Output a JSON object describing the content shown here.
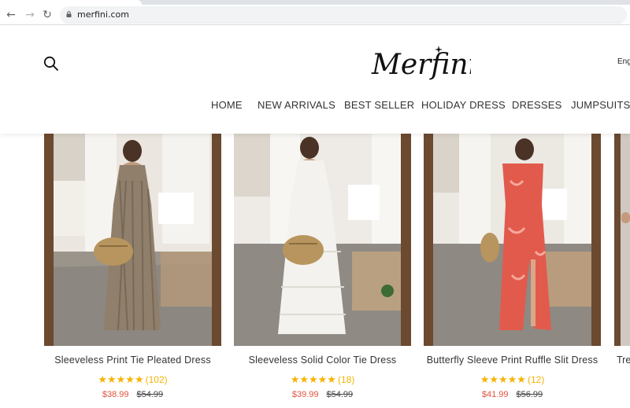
{
  "browser": {
    "url": "merfini.com",
    "back_icon": "arrow-left-icon",
    "forward_icon": "arrow-right-icon",
    "reload_icon": "reload-icon"
  },
  "header": {
    "logo_text": "Merfini",
    "language": "Eng",
    "search_icon": "search-icon",
    "nav": [
      "HOME",
      "NEW ARRIVALS",
      "BEST SELLER",
      "HOLIDAY DRESS",
      "DRESSES",
      "JUMPSUITS"
    ]
  },
  "products": [
    {
      "name": "Sleeveless Print Tie Pleated Dress",
      "stars": "★★★★★",
      "reviews": "(102)",
      "sale_price": "$38.99",
      "original_price": "$54.99",
      "dress_color": "#8f7f6b"
    },
    {
      "name": "Sleeveless Solid Color Tie Dress",
      "stars": "★★★★★",
      "reviews": "(18)",
      "sale_price": "$39.99",
      "original_price": "$54.99",
      "dress_color": "#f4f2ee"
    },
    {
      "name": "Butterfly Sleeve Print Ruffle Slit Dress",
      "stars": "★★★★★",
      "reviews": "(12)",
      "sale_price": "$41.99",
      "original_price": "$56.99",
      "dress_color": "#e25a4c"
    }
  ],
  "partial_product": {
    "name": "Tre"
  },
  "colors": {
    "sale": "#e0533c",
    "star": "#f5b301"
  }
}
